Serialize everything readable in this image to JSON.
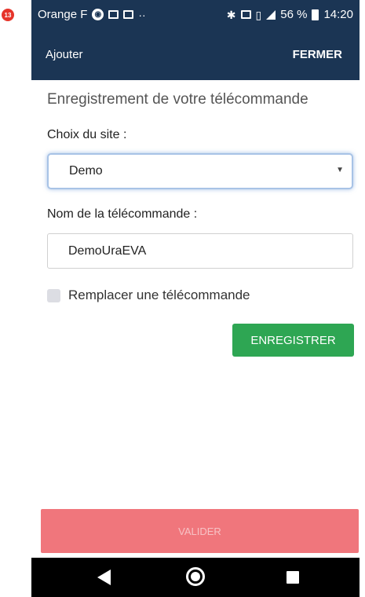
{
  "step_badge": "13",
  "colors": {
    "header": "#1b3554",
    "accent_green": "#2ea653",
    "valider_disabled": "#f0767c",
    "step_badge": "#e6342a"
  },
  "status_bar": {
    "carrier": "Orange F",
    "battery": "56 %",
    "time": "14:20",
    "icons": [
      "sim-icon",
      "outlook-icon",
      "image-icon",
      "more-dots-icon",
      "bluetooth-icon",
      "nfc-icon",
      "vibrate-icon",
      "signal-icon",
      "battery-icon"
    ]
  },
  "app_bar": {
    "title": "Ajouter",
    "close_label": "FERMER"
  },
  "form": {
    "heading": "Enregistrement de votre télécommande",
    "site_label": "Choix du site :",
    "site_value": "Demo",
    "remote_name_label": "Nom de la télécommande :",
    "remote_name_value": "DemoUraEVA",
    "replace_label": "Remplacer une télécommande",
    "register_button": "ENREGISTRER"
  },
  "footer": {
    "validate_button": "VALIDER"
  },
  "nav_bar": {
    "icons": [
      "back-icon",
      "home-icon",
      "recent-apps-icon"
    ]
  }
}
